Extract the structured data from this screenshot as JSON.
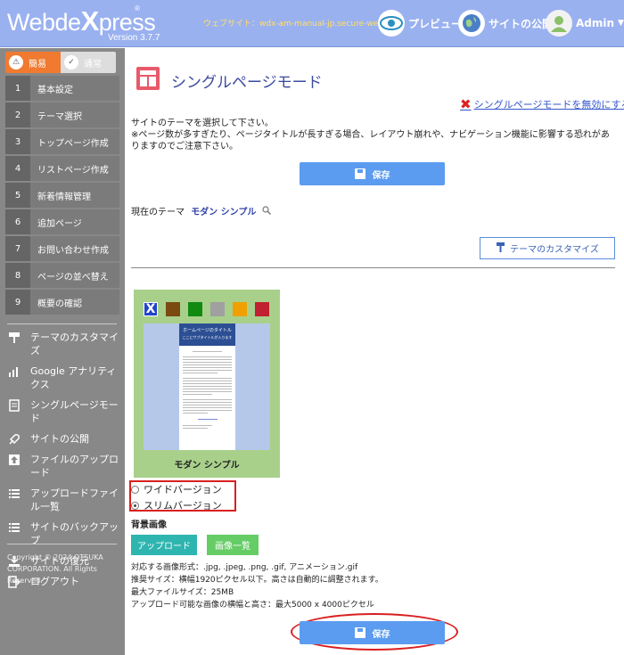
{
  "header": {
    "logo_pre": "Webde",
    "logo_x": "X",
    "logo_post": "press",
    "logo_reg": "®",
    "version": "Version 3.7.7",
    "site_url": "ウェブサイト：wdx-am-manual-jp.secure-web.jp",
    "preview_label": "プレビュー",
    "publish_label": "サイトの公開",
    "admin_label": "Admin",
    "admin_caret": "▼"
  },
  "sidebar": {
    "mode_easy": "簡易",
    "mode_normal": "通常",
    "steps": [
      {
        "num": "1",
        "label": "基本設定"
      },
      {
        "num": "2",
        "label": "テーマ選択"
      },
      {
        "num": "3",
        "label": "トップページ作成"
      },
      {
        "num": "4",
        "label": "リストページ作成"
      },
      {
        "num": "5",
        "label": "新着情報管理"
      },
      {
        "num": "6",
        "label": "追加ページ"
      },
      {
        "num": "7",
        "label": "お問い合わせ作成"
      },
      {
        "num": "8",
        "label": "ページの並べ替え"
      },
      {
        "num": "9",
        "label": "概要の確認"
      }
    ],
    "menu": [
      {
        "label": "テーマのカスタマイズ",
        "icon": "brush-icon"
      },
      {
        "label": "Google アナリティクス",
        "icon": "analytics-icon"
      },
      {
        "label": "シングルページモード",
        "icon": "single-page-icon"
      },
      {
        "label": "サイトの公開",
        "icon": "rocket-icon"
      },
      {
        "label": "ファイルのアップロード",
        "icon": "upload-icon"
      },
      {
        "label": "アップロードファイル一覧",
        "icon": "list-icon"
      },
      {
        "label": "サイトのバックアップ",
        "icon": "backup-icon"
      },
      {
        "label": "サイトの復元",
        "icon": "restore-icon"
      },
      {
        "label": "ログアウト",
        "icon": "logout-icon"
      }
    ],
    "copyright": "Copyright © 2024 OTSUKA CORPORATION. All Rights Reserved."
  },
  "main": {
    "title": "シングルページモード",
    "disable_link": "シングルページモードを無効にする",
    "intro_line1": "サイトのテーマを選択して下さい。",
    "intro_line2": "※ページ数が多すぎたり、ページタイトルが長すぎる場合、レイアウト崩れや、ナビゲーション機能に影響する恐れがありますのでご注意下さい。",
    "save_label": "保存",
    "current_theme_label": "現在のテーマ",
    "current_theme_name": "モダン シンプル",
    "customize_label": "テーマのカスタマイズ",
    "theme_card_name": "モダン シンプル",
    "preview_title": "ホームページのタイトル",
    "preview_subtitle": "ここにサブタイトルが入ります",
    "swatch_x": "X",
    "swatch_colors": [
      "#2244cc",
      "#7a4a10",
      "#108a10",
      "#a0a0a0",
      "#f0a000",
      "#c02030"
    ],
    "radio_wide": "ワイドバージョン",
    "radio_slim": "スリムバージョン",
    "selected_version": "スリムバージョン",
    "bg_image_label": "背景画像",
    "upload_label": "アップロード",
    "list_label": "画像一覧",
    "spec_formats": "対応する画像形式：.jpg, .jpeg, .png, .gif, アニメーション.gif",
    "spec_recommended": "推奨サイズ：横幅1920ピクセル以下。高さは自動的に調整されます。",
    "spec_max_file": "最大ファイルサイズ：25MB",
    "spec_max_dims": "アップロード可能な画像の横幅と高さ：最大5000 x 4000ピクセル"
  }
}
